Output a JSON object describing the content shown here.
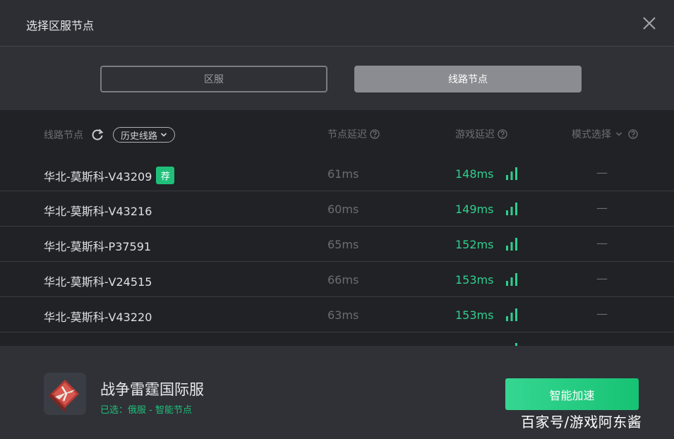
{
  "dialog": {
    "title": "选择区服节点"
  },
  "tabs": [
    {
      "label": "区服",
      "active": false
    },
    {
      "label": "线路节点",
      "active": true
    }
  ],
  "list": {
    "headers": {
      "node": "线路节点",
      "history": "历史线路",
      "node_latency": "节点延迟",
      "game_latency": "游戏延迟",
      "mode": "模式选择"
    },
    "rows": [
      {
        "name": "华北-莫斯科-V43209",
        "badge": "荐",
        "node_latency": "61ms",
        "game_latency": "148ms",
        "mode": "—"
      },
      {
        "name": "华北-莫斯科-V43216",
        "node_latency": "60ms",
        "game_latency": "149ms",
        "mode": "—"
      },
      {
        "name": "华北-莫斯科-P37591",
        "node_latency": "65ms",
        "game_latency": "152ms",
        "mode": "—"
      },
      {
        "name": "华北-莫斯科-V24515",
        "node_latency": "66ms",
        "game_latency": "153ms",
        "mode": "—"
      },
      {
        "name": "华北-莫斯科-V43220",
        "node_latency": "63ms",
        "game_latency": "153ms",
        "mode": "—"
      }
    ]
  },
  "footer": {
    "game_name": "战争雷霆国际服",
    "selected": "已选：俄服 - 智能节点",
    "accelerate_label": "智能加速",
    "watermark": "百家号/游戏阿东酱"
  },
  "colors": {
    "accent_green": "#2fcf8d",
    "badge_green": "#1fbf7a",
    "background": "#2b2d33",
    "list_background": "#212226"
  },
  "icons": [
    "close-icon",
    "refresh-icon",
    "chevron-down-icon",
    "help-icon",
    "signal-icon",
    "game-icon"
  ]
}
